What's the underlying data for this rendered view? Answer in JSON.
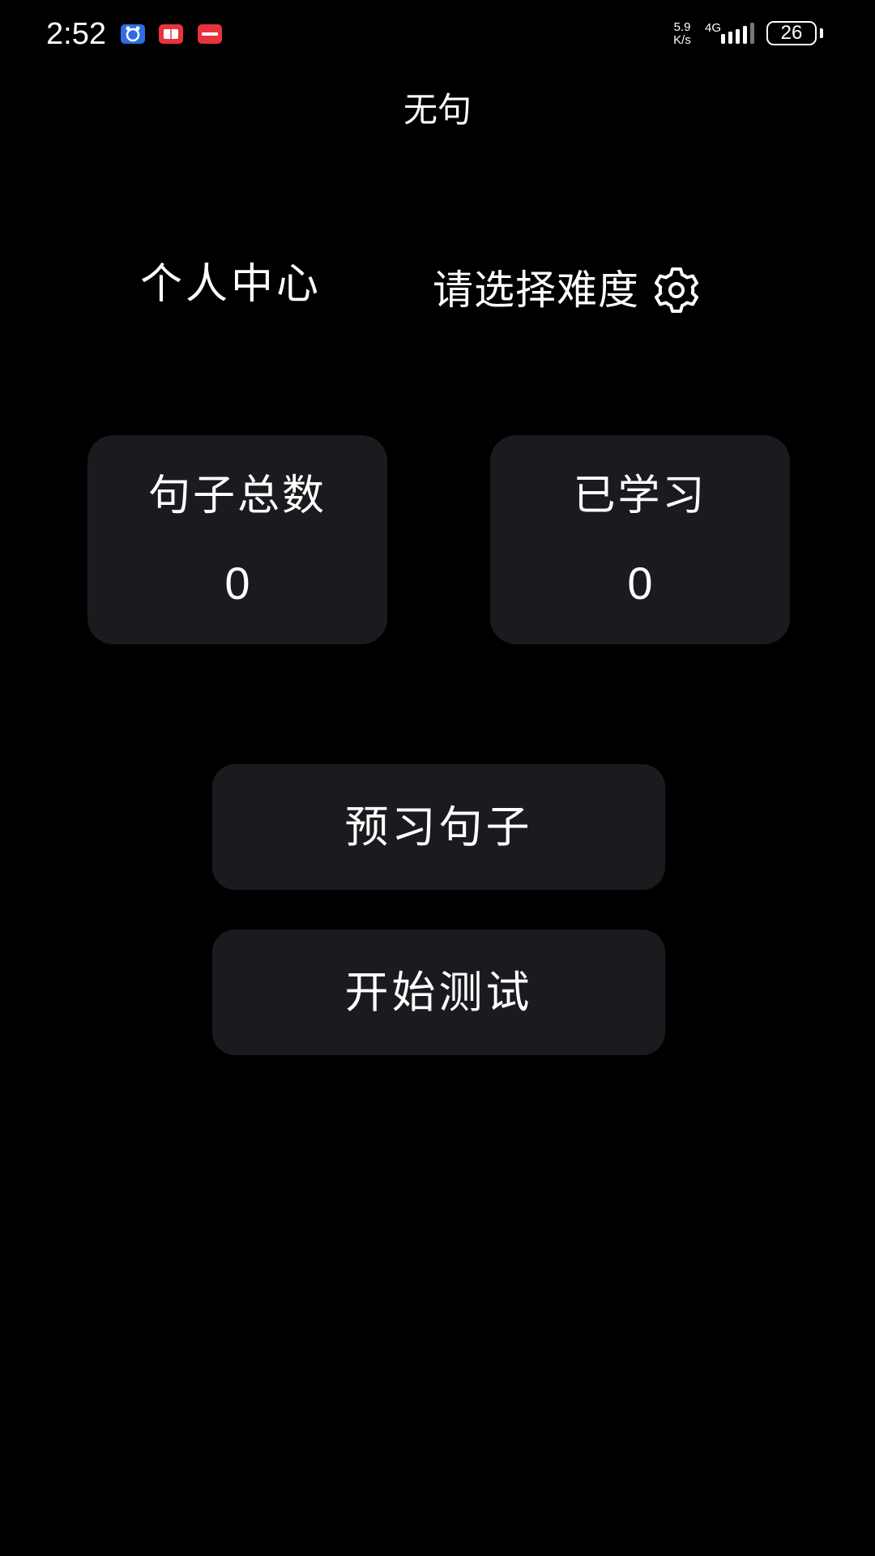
{
  "status_bar": {
    "time": "2:52",
    "net_speed_value": "5.9",
    "net_speed_unit": "K/s",
    "network_type": "4G",
    "battery_level": "26",
    "notification_icons": [
      "alarm-clock-icon",
      "book-icon",
      "red-app-icon"
    ]
  },
  "app": {
    "title": "无句"
  },
  "top_links": {
    "personal_center": "个人中心",
    "difficulty": "请选择难度"
  },
  "stats": {
    "total_label": "句子总数",
    "total_value": "0",
    "learned_label": "已学习",
    "learned_value": "0"
  },
  "actions": {
    "preview": "预习句子",
    "test": "开始测试"
  },
  "colors": {
    "background": "#000000",
    "card": "#1a1b1f",
    "text": "#ffffff"
  }
}
